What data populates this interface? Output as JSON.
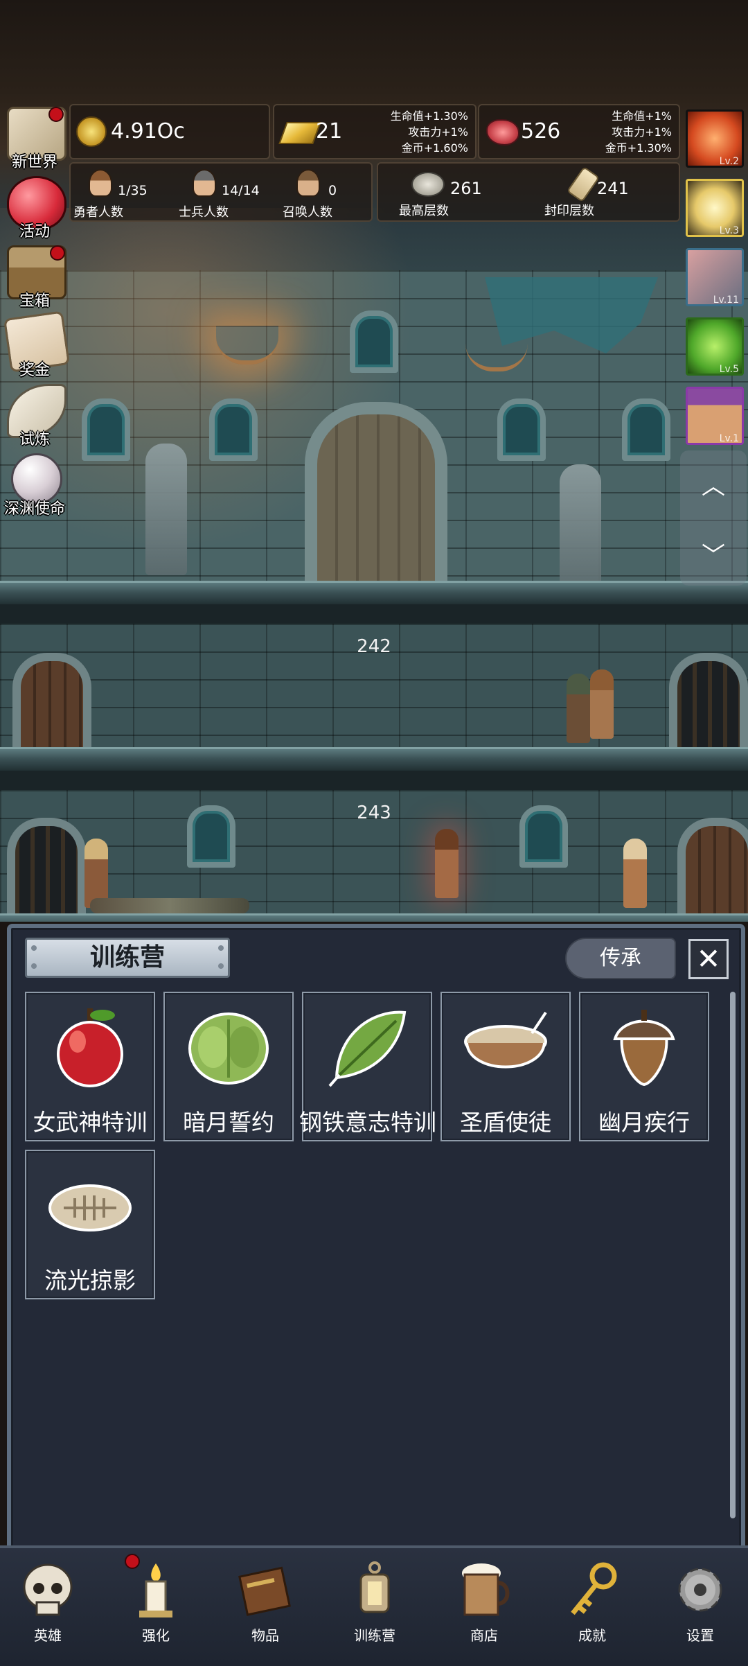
{
  "resources": {
    "coins": "4.91Oc",
    "gold": "21",
    "gold_bonus": [
      "生命值+1.30%",
      "攻击力+1%",
      "金币+1.60%"
    ],
    "meat": "526",
    "meat_bonus": [
      "生命值+1%",
      "攻击力+1%",
      "金币+1.30%"
    ]
  },
  "population": {
    "heroes": {
      "value": "1/35",
      "label": "勇者人数"
    },
    "soldiers": {
      "value": "14/14",
      "label": "士兵人数"
    },
    "summons": {
      "value": "0",
      "label": "召唤人数"
    }
  },
  "floors": {
    "highest": {
      "value": "261",
      "label": "最高层数"
    },
    "sealed": {
      "value": "241",
      "label": "封印层数"
    }
  },
  "side_menu": [
    {
      "label": "新世界",
      "icon": "map-scroll-icon",
      "dot": true
    },
    {
      "label": "活动",
      "icon": "heart-icon",
      "dot": false
    },
    {
      "label": "宝箱",
      "icon": "treasure-chest-icon",
      "dot": true
    },
    {
      "label": "奖金",
      "icon": "envelope-icon",
      "dot": false
    },
    {
      "label": "试炼",
      "icon": "feather-icon",
      "dot": false
    },
    {
      "label": "深渊使命",
      "icon": "pearl-icon",
      "dot": false
    }
  ],
  "buffs": [
    {
      "icon": "apple-buff-icon",
      "level": "Lv.2"
    },
    {
      "icon": "candle-buff-icon",
      "level": "Lv.3"
    },
    {
      "icon": "scroll-buff-icon",
      "level": "Lv.11"
    },
    {
      "icon": "slime-buff-icon",
      "level": "Lv.5"
    },
    {
      "icon": "portrait-buff-icon",
      "level": "Lv.1"
    }
  ],
  "scene": {
    "floor_a": "242",
    "floor_b": "243"
  },
  "training_camp": {
    "title": "训练营",
    "inherit_label": "传承",
    "close_label": "✕",
    "items": [
      {
        "label": "女武神特训",
        "icon": "apple-icon"
      },
      {
        "label": "暗月誓约",
        "icon": "cabbage-icon"
      },
      {
        "label": "钢铁意志特训",
        "icon": "leaf-icon"
      },
      {
        "label": "圣盾使徒",
        "icon": "porridge-bowl-icon"
      },
      {
        "label": "幽月疾行",
        "icon": "acorn-icon"
      },
      {
        "label": "流光掠影",
        "icon": "fish-fossil-icon"
      }
    ]
  },
  "bottom_nav": [
    {
      "label": "英雄",
      "icon": "skull-icon",
      "dot": false
    },
    {
      "label": "强化",
      "icon": "candle-icon",
      "dot": true
    },
    {
      "label": "物品",
      "icon": "book-icon",
      "dot": false
    },
    {
      "label": "训练营",
      "icon": "lantern-icon",
      "dot": false
    },
    {
      "label": "商店",
      "icon": "beer-mug-icon",
      "dot": false
    },
    {
      "label": "成就",
      "icon": "key-icon",
      "dot": false
    },
    {
      "label": "设置",
      "icon": "gear-icon",
      "dot": false
    }
  ]
}
